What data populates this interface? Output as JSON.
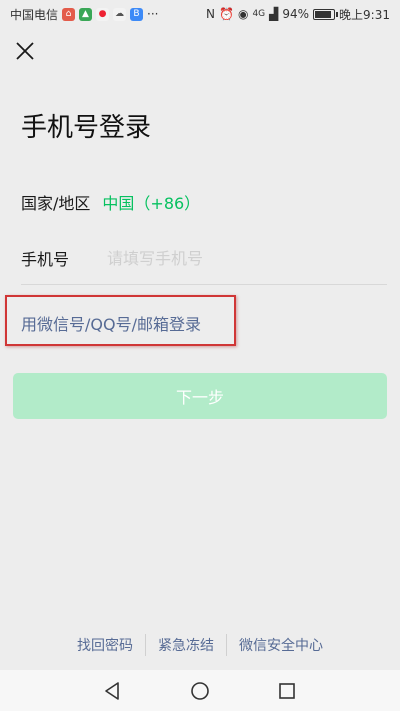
{
  "status_bar": {
    "carrier": "中国电信",
    "battery": "94%",
    "battery_level": 0.94,
    "time": "晚上9:31",
    "network": "4G",
    "more": "···",
    "icons": [
      "app-notification-icon",
      "nfc-icon",
      "alarm-icon",
      "eye-comfort-icon",
      "signal-icon",
      "battery-icon"
    ]
  },
  "header": {
    "close_icon": "close-icon"
  },
  "login": {
    "title": "手机号登录",
    "region_label": "国家/地区",
    "region_value": "中国（+86）",
    "phone_label": "手机号",
    "phone_placeholder": "请填写手机号",
    "phone_value": "",
    "alt_login_link": "用微信号/QQ号/邮箱登录",
    "next_button": "下一步"
  },
  "footer": {
    "links": [
      "找回密码",
      "紧急冻结",
      "微信安全中心"
    ]
  },
  "nav_bar": {
    "buttons": [
      "back-icon",
      "home-icon",
      "recents-icon"
    ]
  },
  "colors": {
    "accent_green": "#07c160",
    "link_blue": "#576b95",
    "disabled_button": "#b2ebc9",
    "highlight_box": "#d03636",
    "background": "#ededed"
  }
}
